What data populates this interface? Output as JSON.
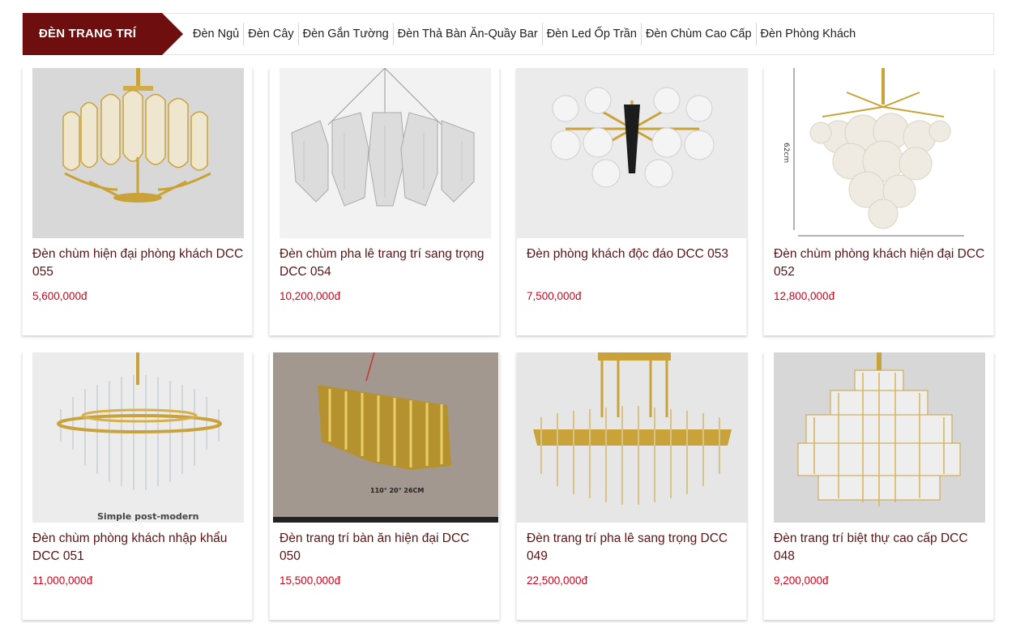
{
  "header": {
    "category_label": "ĐÈN TRANG TRÍ",
    "nav": [
      "Đèn Ngủ",
      "Đèn Cây",
      "Đèn Gắn Tường",
      "Đèn Thả Bàn Ăn-Quầy Bar",
      "Đèn Led Ốp Trần",
      "Đèn Chùm Cao Cấp",
      "Đèn Phòng Khách"
    ]
  },
  "colors": {
    "brand": "#6e0e0e",
    "price": "#d0021b",
    "title": "#5a1414"
  },
  "products": [
    {
      "title": "Đèn chùm hiện đại phòng khách DCC 055",
      "price": "5,600,000đ"
    },
    {
      "title": "Đèn chùm pha lê trang trí sang trọng DCC 054",
      "price": "10,200,000đ"
    },
    {
      "title": "Đèn phòng khách độc đáo DCC 053",
      "price": "7,500,000đ"
    },
    {
      "title": "Đèn chùm phòng khách hiện đại DCC 052",
      "price": "12,800,000đ",
      "image_text": "62cm"
    },
    {
      "title": "Đèn chùm phòng khách nhập khẩu DCC 051",
      "price": "11,000,000đ",
      "image_text": "Simple post-modern"
    },
    {
      "title": "Đèn trang trí bàn ăn hiện đại DCC 050",
      "price": "15,500,000đ",
      "image_text": "110°  20°  26CM"
    },
    {
      "title": "Đèn trang trí pha lê sang trọng DCC 049",
      "price": "22,500,000đ"
    },
    {
      "title": "Đèn trang trí biệt thự cao cấp DCC 048",
      "price": "9,200,000đ"
    }
  ]
}
